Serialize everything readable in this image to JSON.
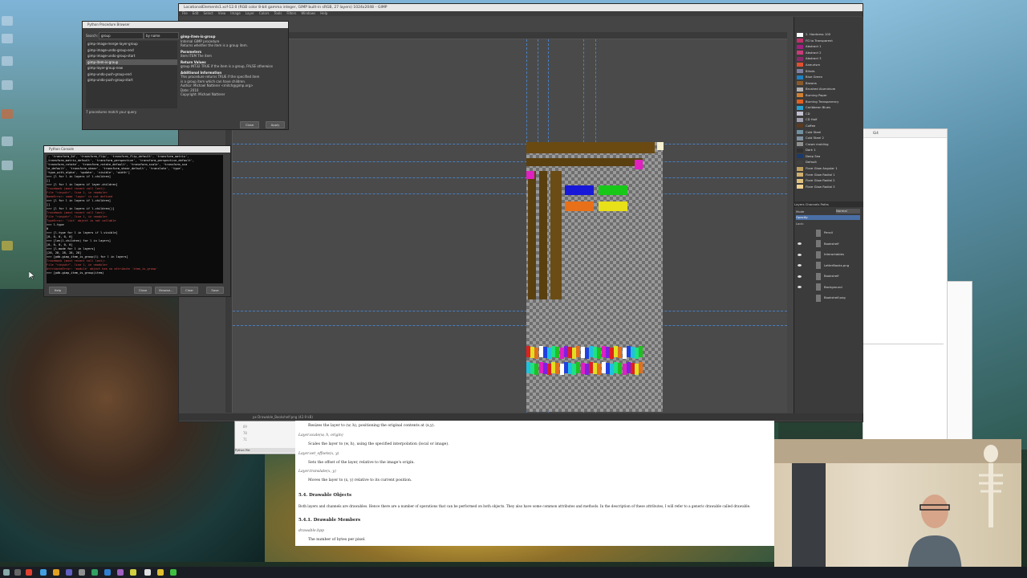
{
  "gimp": {
    "title": "LocationalElements1.xcf-12.0 (RGB color 8-bit gamma integer, GIMP built-in sRGB, 27 layers) 1024x2048 – GIMP",
    "menu": [
      "File",
      "Edit",
      "Select",
      "View",
      "Image",
      "Layer",
      "Colors",
      "Tools",
      "Filters",
      "Windows",
      "Help"
    ],
    "status": "px  Drawable_Bookshelf.png (42.9 kB)",
    "brushes": [
      {
        "name": "2. Hardness 100",
        "color": "#ffffff"
      },
      {
        "name": "FG to Transparent",
        "color": "#c0306a"
      },
      {
        "name": "Abstract 1",
        "color": "#a02080"
      },
      {
        "name": "Abstract 2",
        "color": "#c83c78"
      },
      {
        "name": "Abstract 3",
        "color": "#8a2a6a"
      },
      {
        "name": "Aneurism",
        "color": "#e05030"
      },
      {
        "name": "Blinds",
        "color": "#8080a0"
      },
      {
        "name": "Blue Green",
        "color": "#2080c0"
      },
      {
        "name": "Browns",
        "color": "#8a5a2a"
      },
      {
        "name": "Brushed Aluminium",
        "color": "#b0b0b0"
      },
      {
        "name": "Burning Paper",
        "color": "#d08030"
      },
      {
        "name": "Burning Transparency",
        "color": "#e06020"
      },
      {
        "name": "Caribbean Blues",
        "color": "#2aa0d0"
      },
      {
        "name": "CD",
        "color": "#c0c0d0"
      },
      {
        "name": "CD Half",
        "color": "#a0a0b0"
      },
      {
        "name": "Coffee",
        "color": "#5a3a20"
      },
      {
        "name": "Cold Steel",
        "color": "#7090a0"
      },
      {
        "name": "Cold Steel 2",
        "color": "#8090a0"
      },
      {
        "name": "Crown molding",
        "color": "#909090"
      },
      {
        "name": "Dark 1",
        "color": "#303030"
      },
      {
        "name": "Deep Sea",
        "color": "#1a3a6a"
      },
      {
        "name": "Default",
        "color": "#404040"
      },
      {
        "name": "Flare Glow Angular 1",
        "color": "#c0a060"
      },
      {
        "name": "Flare Glow Radial 1",
        "color": "#d0b070"
      },
      {
        "name": "Flare Glow Radial 2",
        "color": "#e0c080"
      },
      {
        "name": "Flare Glow Radial 3",
        "color": "#f0d090"
      }
    ],
    "layers_tabs": "Layers  Channels  Paths",
    "mode_label": "Mode",
    "mode_value": "Normal",
    "opacity_label": "Opacity",
    "lock_label": "Lock:",
    "layers": [
      {
        "name": "Pencil",
        "visible": false
      },
      {
        "name": "Bookshelf",
        "visible": true
      },
      {
        "name": "Interactables",
        "visible": true
      },
      {
        "name": "LetterBooks.png",
        "visible": true
      },
      {
        "name": "Bookshelf",
        "visible": true
      },
      {
        "name": "Background",
        "visible": true
      },
      {
        "name": "Bookshelf.png",
        "visible": false
      }
    ]
  },
  "procedure_browser": {
    "title": "Python Procedure Browser",
    "search_label": "Search:",
    "search_value": "group",
    "search_mode": "by name",
    "procedures": [
      "gimp-image-merge-layer-group",
      "gimp-image-undo-group-end",
      "gimp-image-undo-group-start",
      "gimp-item-is-group",
      "gimp-layer-group-new",
      "gimp-undo-push-group-end",
      "gimp-undo-push-group-start"
    ],
    "selected_index": 3,
    "count_text": "7 procedures match your query",
    "info": {
      "name": "gimp-item-is-group",
      "kind": "Internal GIMP procedure",
      "desc": "Returns whether the item is a group item.",
      "params_h": "Parameters",
      "param1": "item   ITEM   The item",
      "return_h": "Return Values",
      "return1": "group  INT32  TRUE if the item is a group, FALSE otherwise",
      "addl_h": "Additional Information",
      "addl1": "This procedure returns TRUE if the specified item",
      "addl2": "is a group item which can have children.",
      "author": "Author:     Michael Natterer <mitch@gimp.org>",
      "date": "Date:        2010",
      "copyright": "Copyright:  Michael Natterer"
    },
    "close_label": "Close",
    "apply_label": "Apply"
  },
  "python_console": {
    "title": "Python Console",
    "lines": [
      {
        "t": "', 'transform_2d', 'transform_flip', 'transform_flip_default', 'transform_matrix',",
        "e": false
      },
      {
        "t": "_transform_matrix_default', 'transform_perspective', 'transform_perspective_default',",
        "e": false
      },
      {
        "t": " 'transform_rotate', 'transform_rotate_default', 'transform_scale', 'transform_sca",
        "e": false
      },
      {
        "t": "le_default', 'transform_shear', 'transform_shear_default', 'translate', 'type',",
        "e": false
      },
      {
        "t": " 'type_with_alpha', 'update', 'visible', 'width']",
        "e": false
      },
      {
        "t": ">>> [l for l in layers if l.children]",
        "e": false
      },
      {
        "t": "[]",
        "e": false
      },
      {
        "t": ">>> [l for l in layers if layer.children]",
        "e": false
      },
      {
        "t": "Traceback (most recent call last):",
        "e": true
      },
      {
        "t": "  File \"<input>\", line 1, in <module>",
        "e": true
      },
      {
        "t": "NameError: name 'layer' is not defined",
        "e": true
      },
      {
        "t": ">>> [l for l in layers if l.children]",
        "e": false
      },
      {
        "t": "[]",
        "e": false
      },
      {
        "t": ">>> [l for l in layers if l.children()]",
        "e": false
      },
      {
        "t": "Traceback (most recent call last):",
        "e": true
      },
      {
        "t": "  File \"<input>\", line 1, in <module>",
        "e": true
      },
      {
        "t": "TypeError: 'list' object is not callable",
        "e": true
      },
      {
        "t": ">>> l.type",
        "e": false
      },
      {
        "t": "0",
        "e": false
      },
      {
        "t": ">>> [l.type for l in layers if l.visible]",
        "e": false
      },
      {
        "t": "[0, 0, 0, 0, 0]",
        "e": false
      },
      {
        "t": ">>> [len(l.children) for l in layers]",
        "e": false
      },
      {
        "t": "[0, 0, 0, 0, 0]",
        "e": false
      },
      {
        "t": ">>> [l.mode for l in layers]",
        "e": false
      },
      {
        "t": "[28, 28, 28, 28, 28]",
        "e": false
      },
      {
        "t": ">>> [pdb.gimp_item_is_group(l) for l in layers]",
        "e": false
      },
      {
        "t": "Traceback (most recent call last):",
        "e": true
      },
      {
        "t": "  File \"<input>\", line 1, in <module>",
        "e": true
      },
      {
        "t": "AttributeError: 'module' object has no attribute 'item_is_group'",
        "e": true
      },
      {
        "t": ">>> [pdb.gimp_item_is_group(item)",
        "e": false
      }
    ],
    "help_label": "Help",
    "close_label": "Close",
    "browse_label": "Browse...",
    "clear_label": "Clear",
    "save_label": "Save"
  },
  "doc": {
    "l1": "Resizes the layer to (w, h), positioning the original contents at (x,y).",
    "l2": "Layer.scale(w, h, origin)",
    "l3": "Scales the layer to (w, h), using the specified interpolation (local or image).",
    "l4": "Layer.set_offsets(x, y)",
    "l5": "Sets the offset of the layer, relative to the image's origin.",
    "l6": "Layer.translate(x, y)",
    "l7": "Moves the layer to (x, y) relative to its current position.",
    "h1": "5.4. Drawable Objects",
    "p1": "Both layers and channels are drawables. Hence there are a number of operations that can be performed on both objects. They also have some common attributes and methods. In the description of these attributes, I will refer to a generic drawable called drawable.",
    "h2": "5.4.1. Drawable Members",
    "l8": "drawable.bpp",
    "l9": "The number of bytes per pixel."
  },
  "tiny_window": {
    "n1": "69",
    "n2": "70",
    "n3": "71",
    "label": "Python File"
  },
  "browser": {
    "tab": "Gi4"
  }
}
